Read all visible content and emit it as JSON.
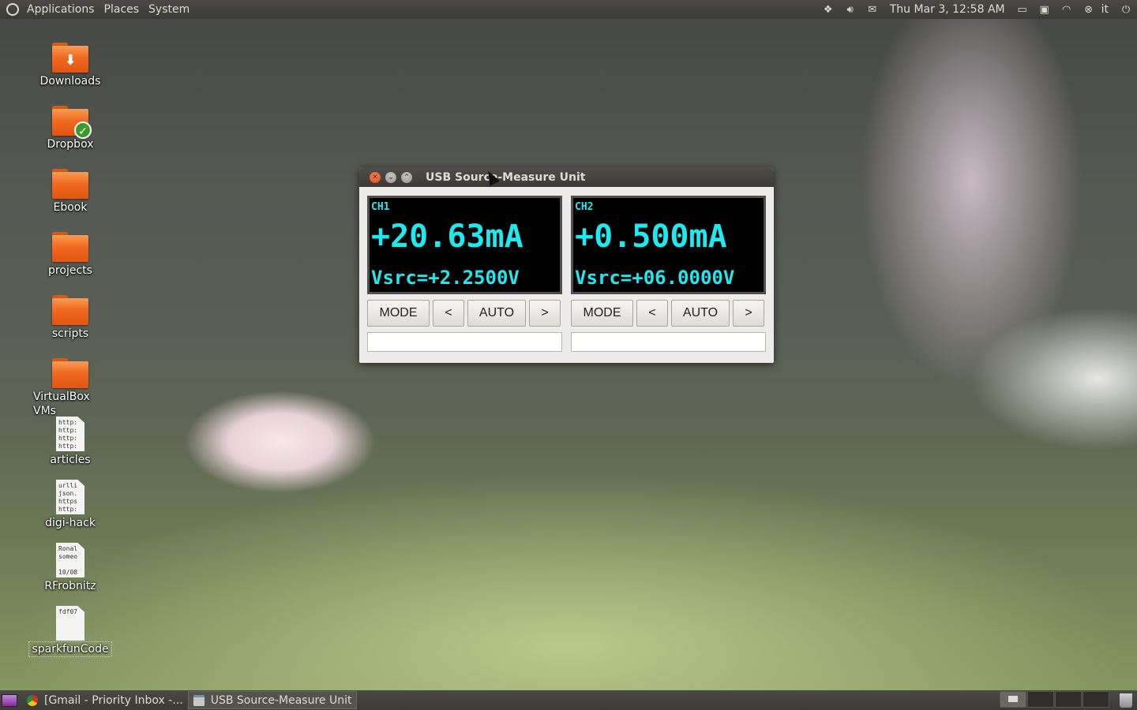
{
  "top_panel": {
    "menus": [
      "Applications",
      "Places",
      "System"
    ],
    "clock": "Thu Mar  3, 12:58 AM",
    "user": "it",
    "tray_icons": [
      "dropbox-icon",
      "volume-icon",
      "mail-icon",
      "keyboard-indicator-icon",
      "update-icon",
      "wifi-icon",
      "user-status-icon",
      "power-icon"
    ]
  },
  "desktop": {
    "icons": [
      {
        "label": "Downloads",
        "kind": "folder",
        "badge": "download-arrow"
      },
      {
        "label": "Dropbox",
        "kind": "folder",
        "badge": "check"
      },
      {
        "label": "Ebook",
        "kind": "folder"
      },
      {
        "label": "projects",
        "kind": "folder"
      },
      {
        "label": "scripts",
        "kind": "folder"
      },
      {
        "label": "VirtualBox VMs",
        "kind": "folder"
      },
      {
        "label": "articles",
        "kind": "text",
        "preview": "http:\nhttp:\nhttp:\nhttp:"
      },
      {
        "label": "digi-hack",
        "kind": "text",
        "preview": "urlli\njson.\nhttps\nhttp:"
      },
      {
        "label": "RFrobnitz",
        "kind": "text",
        "preview": "Ronal\nsomeo\n\n10/08"
      },
      {
        "label": "sparkfunCode",
        "kind": "text",
        "preview": "fdf07"
      }
    ]
  },
  "window": {
    "title": "USB Source-Measure Unit",
    "channels": [
      {
        "name": "CH1",
        "reading": "+20.63mA",
        "vsrc": "Vsrc=+2.2500V",
        "buttons": {
          "mode": "MODE",
          "prev": "<",
          "auto": "AUTO",
          "next": ">"
        },
        "status": ""
      },
      {
        "name": "CH2",
        "reading": "+0.500mA",
        "vsrc": "Vsrc=+06.0000V",
        "buttons": {
          "mode": "MODE",
          "prev": "<",
          "auto": "AUTO",
          "next": ">"
        },
        "status": ""
      }
    ],
    "lcd_color": "#1de9ee"
  },
  "bottom_panel": {
    "tasks": [
      {
        "label": "[Gmail - Priority Inbox -...",
        "icon": "chrome-icon"
      },
      {
        "label": "USB Source-Measure Unit",
        "icon": "window-icon"
      }
    ],
    "workspace_count": 4
  }
}
